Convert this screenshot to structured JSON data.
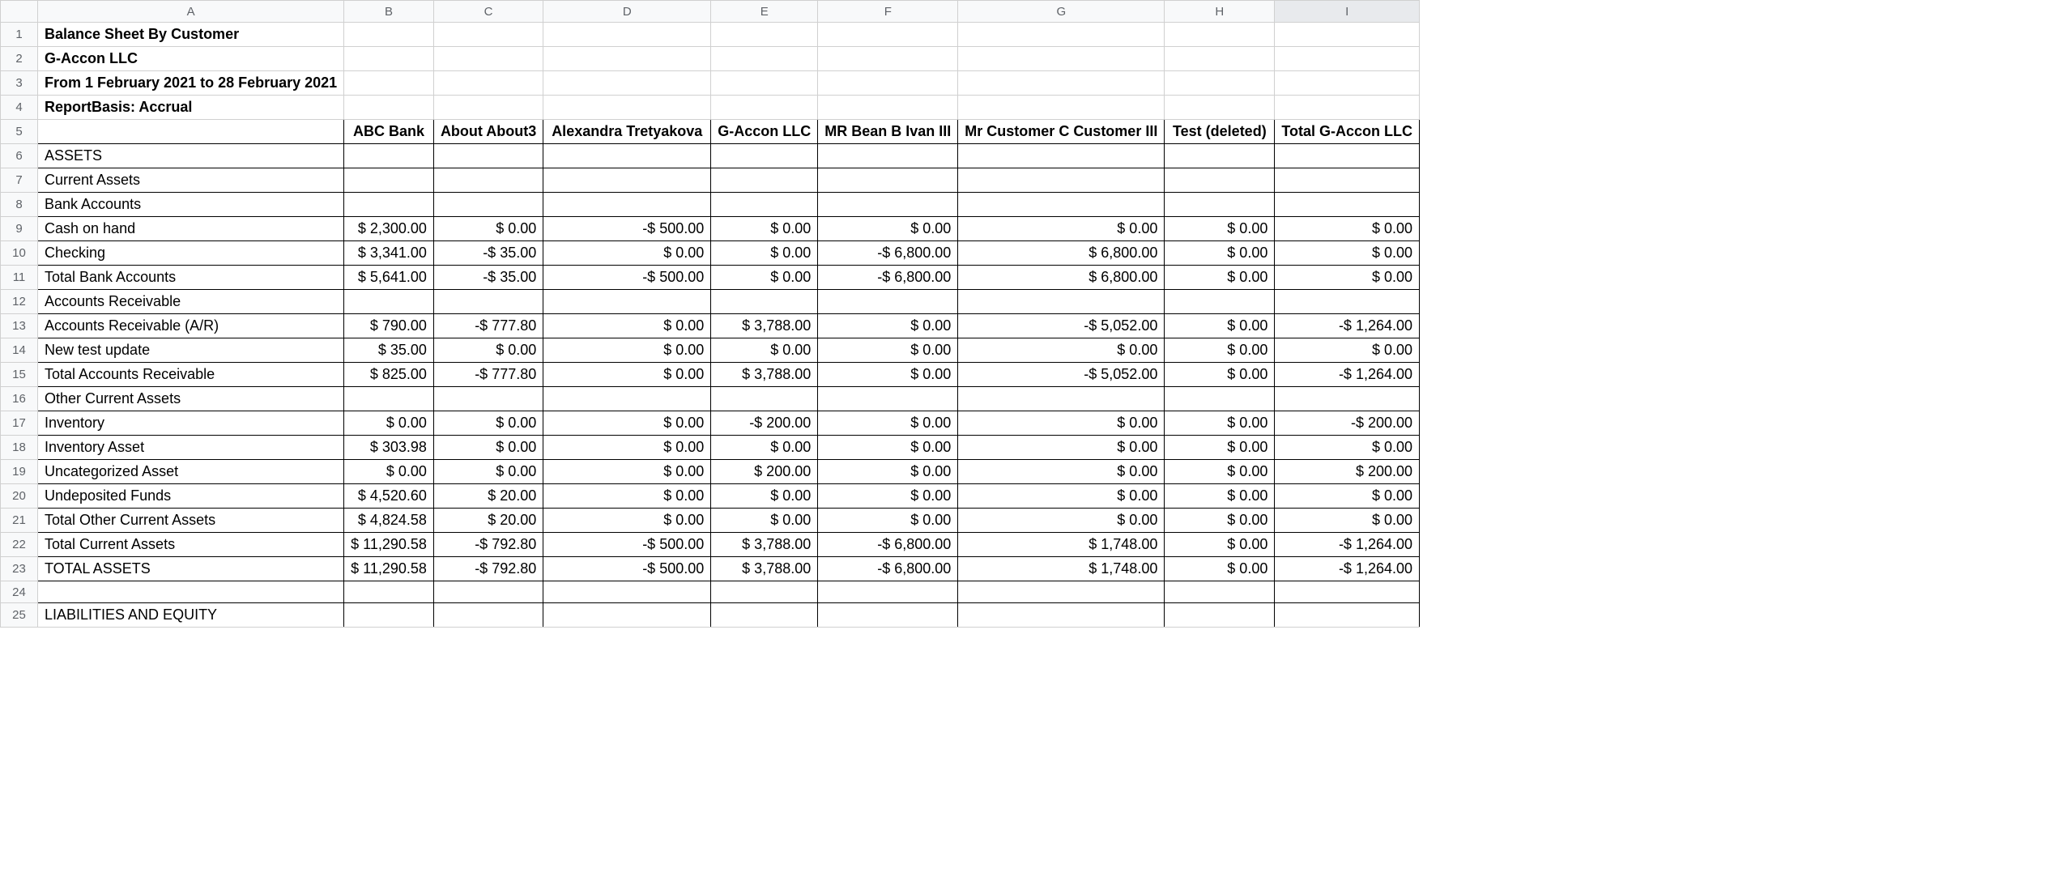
{
  "colHeaders": [
    "A",
    "B",
    "C",
    "D",
    "E",
    "F",
    "G",
    "H",
    "I"
  ],
  "rowCount": 25,
  "title": "Balance Sheet By Customer",
  "company": "G-Accon LLC",
  "period": "From 1 February 2021 to 28 February 2021",
  "basis": "ReportBasis: Accrual",
  "columns": {
    "b": "ABC Bank",
    "c": "About About3",
    "d": "Alexandra Tretyakova",
    "e": "G-Accon LLC",
    "f": "MR Bean B Ivan III",
    "g": "Mr Customer C Customer III",
    "h": "Test (deleted)",
    "i": "Total G-Accon LLC"
  },
  "labels": {
    "assets": "ASSETS",
    "current_assets": "Current Assets",
    "bank_accounts": "Bank Accounts",
    "cash_on_hand": "Cash on hand",
    "checking": "Checking",
    "total_bank": "Total Bank Accounts",
    "ar_section": "Accounts Receivable",
    "ar": "Accounts Receivable (A/R)",
    "new_test": "New test update",
    "total_ar": "Total Accounts Receivable",
    "other_ca": "Other Current Assets",
    "inventory": "Inventory",
    "inventory_asset": "Inventory Asset",
    "uncat_asset": "Uncategorized Asset",
    "undeposited": "Undeposited Funds",
    "total_other_ca": "Total Other Current Assets",
    "total_ca": "Total Current Assets",
    "total_assets": "TOTAL ASSETS",
    "liab_equity": "LIABILITIES AND EQUITY"
  },
  "data": {
    "cash_on_hand": {
      "b": "$ 2,300.00",
      "c": "$ 0.00",
      "d": "-$ 500.00",
      "e": "$ 0.00",
      "f": "$ 0.00",
      "g": "$ 0.00",
      "h": "$ 0.00",
      "i": "$ 0.00"
    },
    "checking": {
      "b": "$ 3,341.00",
      "c": "-$ 35.00",
      "d": "$ 0.00",
      "e": "$ 0.00",
      "f": "-$ 6,800.00",
      "g": "$ 6,800.00",
      "h": "$ 0.00",
      "i": "$ 0.00"
    },
    "total_bank": {
      "b": "$ 5,641.00",
      "c": "-$ 35.00",
      "d": "-$ 500.00",
      "e": "$ 0.00",
      "f": "-$ 6,800.00",
      "g": "$ 6,800.00",
      "h": "$ 0.00",
      "i": "$ 0.00"
    },
    "ar": {
      "b": "$ 790.00",
      "c": "-$ 777.80",
      "d": "$ 0.00",
      "e": "$ 3,788.00",
      "f": "$ 0.00",
      "g": "-$ 5,052.00",
      "h": "$ 0.00",
      "i": "-$ 1,264.00"
    },
    "new_test": {
      "b": "$ 35.00",
      "c": "$ 0.00",
      "d": "$ 0.00",
      "e": "$ 0.00",
      "f": "$ 0.00",
      "g": "$ 0.00",
      "h": "$ 0.00",
      "i": "$ 0.00"
    },
    "total_ar": {
      "b": "$ 825.00",
      "c": "-$ 777.80",
      "d": "$ 0.00",
      "e": "$ 3,788.00",
      "f": "$ 0.00",
      "g": "-$ 5,052.00",
      "h": "$ 0.00",
      "i": "-$ 1,264.00"
    },
    "inventory": {
      "b": "$ 0.00",
      "c": "$ 0.00",
      "d": "$ 0.00",
      "e": "-$ 200.00",
      "f": "$ 0.00",
      "g": "$ 0.00",
      "h": "$ 0.00",
      "i": "-$ 200.00"
    },
    "inventory_asset": {
      "b": "$ 303.98",
      "c": "$ 0.00",
      "d": "$ 0.00",
      "e": "$ 0.00",
      "f": "$ 0.00",
      "g": "$ 0.00",
      "h": "$ 0.00",
      "i": "$ 0.00"
    },
    "uncat_asset": {
      "b": "$ 0.00",
      "c": "$ 0.00",
      "d": "$ 0.00",
      "e": "$ 200.00",
      "f": "$ 0.00",
      "g": "$ 0.00",
      "h": "$ 0.00",
      "i": "$ 200.00"
    },
    "undeposited": {
      "b": "$ 4,520.60",
      "c": "$ 20.00",
      "d": "$ 0.00",
      "e": "$ 0.00",
      "f": "$ 0.00",
      "g": "$ 0.00",
      "h": "$ 0.00",
      "i": "$ 0.00"
    },
    "total_other_ca": {
      "b": "$ 4,824.58",
      "c": "$ 20.00",
      "d": "$ 0.00",
      "e": "$ 0.00",
      "f": "$ 0.00",
      "g": "$ 0.00",
      "h": "$ 0.00",
      "i": "$ 0.00"
    },
    "total_ca": {
      "b": "$ 11,290.58",
      "c": "-$ 792.80",
      "d": "-$ 500.00",
      "e": "$ 3,788.00",
      "f": "-$ 6,800.00",
      "g": "$ 1,748.00",
      "h": "$ 0.00",
      "i": "-$ 1,264.00"
    },
    "total_assets": {
      "b": "$ 11,290.58",
      "c": "-$ 792.80",
      "d": "-$ 500.00",
      "e": "$ 3,788.00",
      "f": "-$ 6,800.00",
      "g": "$ 1,748.00",
      "h": "$ 0.00",
      "i": "-$ 1,264.00"
    }
  }
}
